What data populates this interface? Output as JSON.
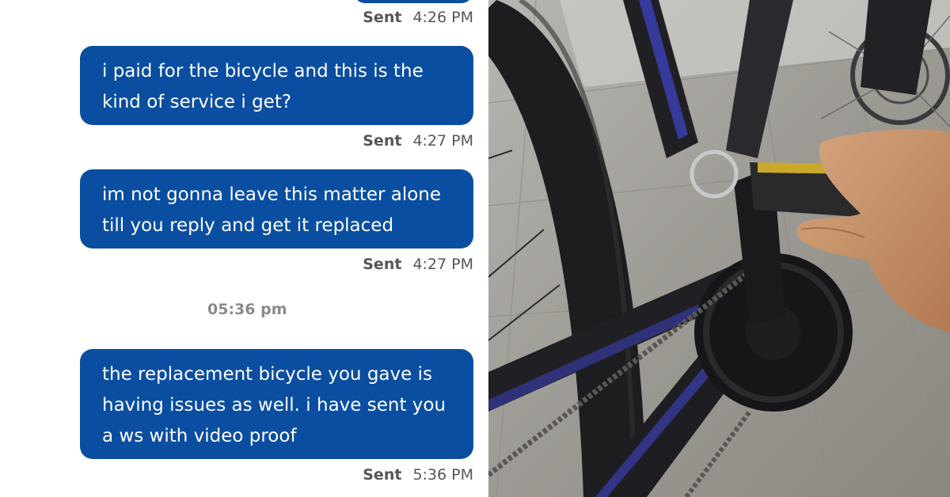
{
  "chat": {
    "messages": [
      {
        "text": "",
        "sent_label": "Sent",
        "time": "4:26 PM"
      },
      {
        "text": "i paid for the bicycle and this is the kind of service i get?",
        "sent_label": "Sent",
        "time": "4:27 PM"
      },
      {
        "text": "im not gonna leave this matter alone till you reply and get it replaced",
        "sent_label": "Sent",
        "time": "4:27 PM"
      },
      {
        "text": "the replacement bicycle you gave is having issues as well. i have sent you a ws with video proof",
        "sent_label": "Sent",
        "time": "5:36 PM"
      }
    ],
    "day_stamp": "05:36 pm",
    "colors": {
      "bubble": "#0a4ea1",
      "bubble_text": "#ffffff",
      "status_text": "#555555",
      "stamp_text": "#8a8a8a"
    }
  },
  "photo": {
    "subject": "bicycle-crank-pedal-photo"
  }
}
